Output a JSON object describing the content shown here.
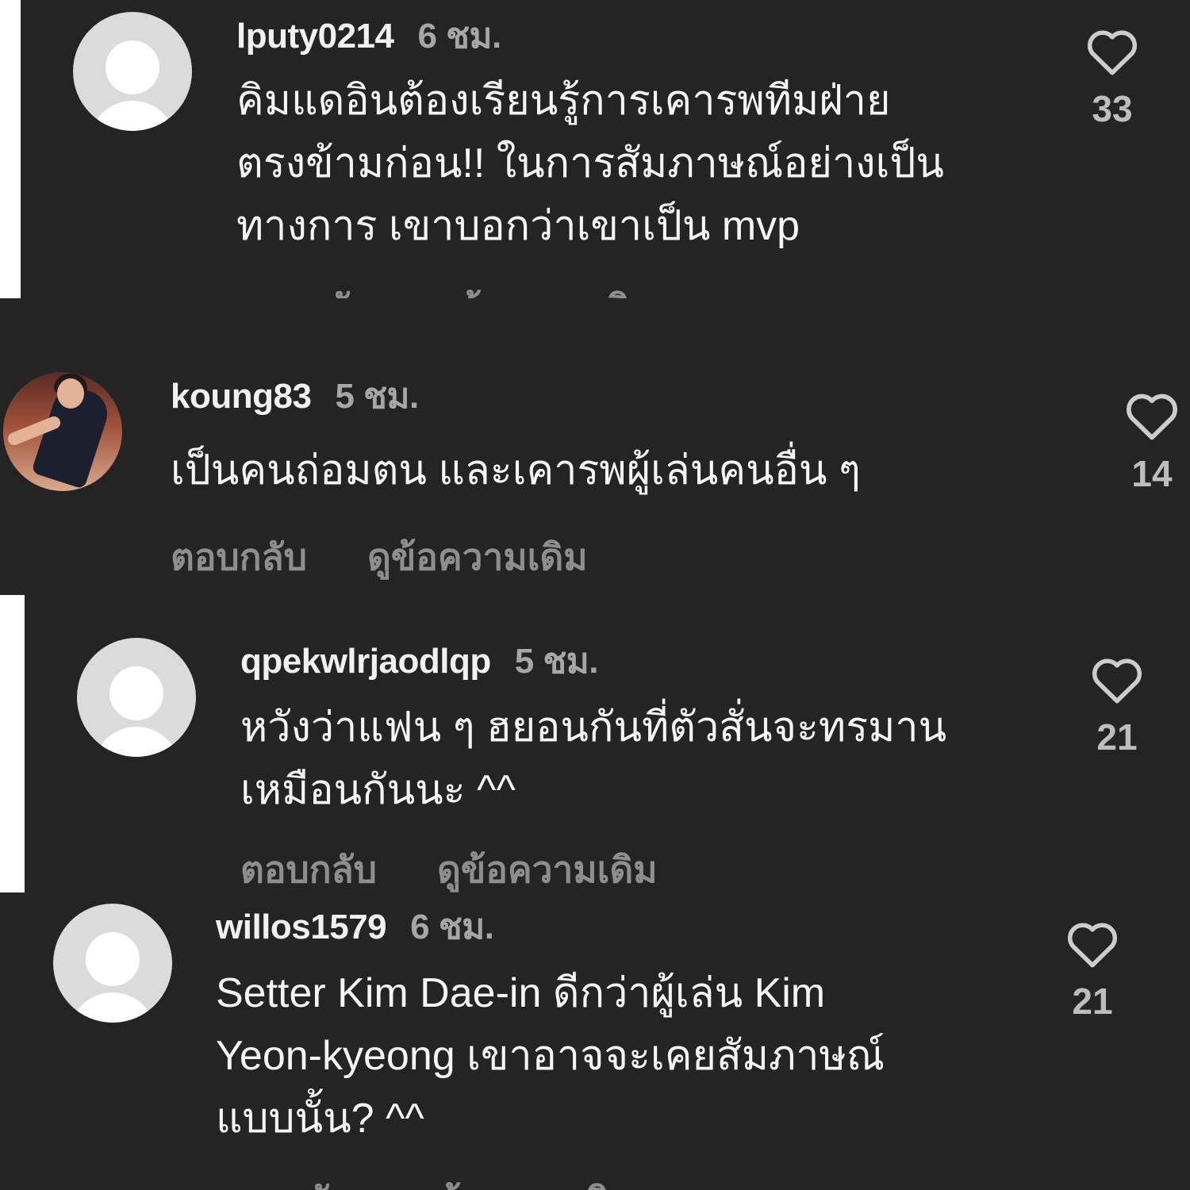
{
  "comments": [
    {
      "username": "lputy0214",
      "time": "6 ชม.",
      "lines": [
        "คิมแดอินต้องเรียนรู้การเคารพทีมฝ่าย",
        "ตรงข้ามก่อน!! ในการสัมภาษณ์อย่างเป็น",
        "ทางการ เขาบอกว่าเขาเป็น mvp"
      ],
      "reply_label": "ตอบกลับ",
      "see_original_label": "ดูข้อความเดิม",
      "likes": "33",
      "avatar": "default-avatar"
    },
    {
      "username": "koung83",
      "time": "5 ชม.",
      "lines": [
        "เป็นคนถ่อมตน และเคารพผู้เล่นคนอื่น ๆ"
      ],
      "reply_label": "ตอบกลับ",
      "see_original_label": "ดูข้อความเดิม",
      "likes": "14",
      "avatar": "photo-avatar"
    },
    {
      "username": "qpekwlrjaodlqp",
      "time": "5 ชม.",
      "lines": [
        "หวังว่าแฟน ๆ ฮยอนกันที่ตัวสั่นจะทรมาน",
        "เหมือนกันนะ ^^"
      ],
      "reply_label": "ตอบกลับ",
      "see_original_label": "ดูข้อความเดิม",
      "likes": "21",
      "avatar": "default-avatar"
    },
    {
      "username": "willos1579",
      "time": "6 ชม.",
      "lines": [
        "Setter Kim Dae-in ดีกว่าผู้เล่น Kim",
        "Yeon-kyeong เขาอาจจะเคยสัมภาษณ์",
        "แบบนั้น? ^^"
      ],
      "reply_label": "ตอบกลับ",
      "see_original_label": "ดูข้อความเดิม",
      "likes": "21",
      "avatar": "default-avatar"
    }
  ],
  "colors": {
    "background": "#242424",
    "username": "#f1f1f1",
    "timestamp": "#a6a6a6",
    "action_text": "#8e8e8e",
    "like_icon": "#cccccc"
  },
  "icons": {
    "like": "heart-outline-icon"
  }
}
